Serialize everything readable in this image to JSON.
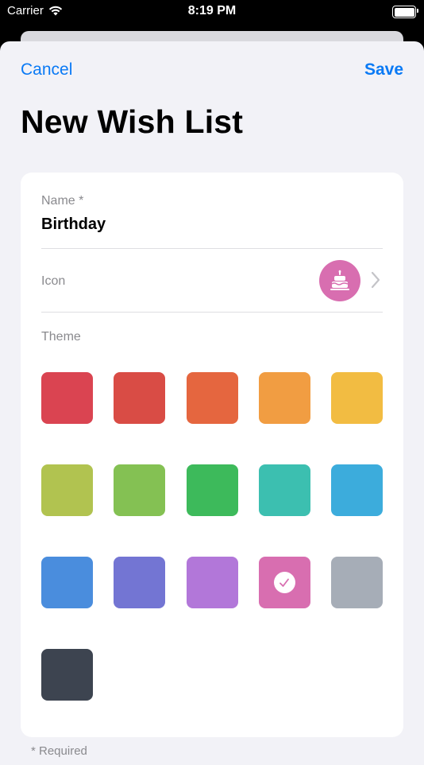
{
  "status_bar": {
    "carrier": "Carrier",
    "time": "8:19 PM",
    "icons": [
      "wifi-icon",
      "battery-icon"
    ]
  },
  "nav": {
    "cancel_label": "Cancel",
    "save_label": "Save",
    "accent_color": "#0a7af5"
  },
  "page": {
    "title": "New Wish List"
  },
  "form": {
    "name_label": "Name *",
    "name_value": "Birthday",
    "icon_label": "Icon",
    "icon_name": "birthday-cake-icon",
    "icon_color": "#d86eb0",
    "theme_label": "Theme",
    "themes": [
      {
        "color": "#da4451",
        "selected": false
      },
      {
        "color": "#d94c45",
        "selected": false
      },
      {
        "color": "#e5663f",
        "selected": false
      },
      {
        "color": "#f19d42",
        "selected": false
      },
      {
        "color": "#f2bc42",
        "selected": false
      },
      {
        "color": "#b1c350",
        "selected": false
      },
      {
        "color": "#84c153",
        "selected": false
      },
      {
        "color": "#3dba5b",
        "selected": false
      },
      {
        "color": "#3cbfb0",
        "selected": false
      },
      {
        "color": "#3cacdc",
        "selected": false
      },
      {
        "color": "#4a8ddd",
        "selected": false
      },
      {
        "color": "#7375d3",
        "selected": false
      },
      {
        "color": "#b277d9",
        "selected": false
      },
      {
        "color": "#d86eb0",
        "selected": true
      },
      {
        "color": "#a6adb7",
        "selected": false
      },
      {
        "color": "#3d4450",
        "selected": false
      }
    ]
  },
  "footnote": "* Required"
}
